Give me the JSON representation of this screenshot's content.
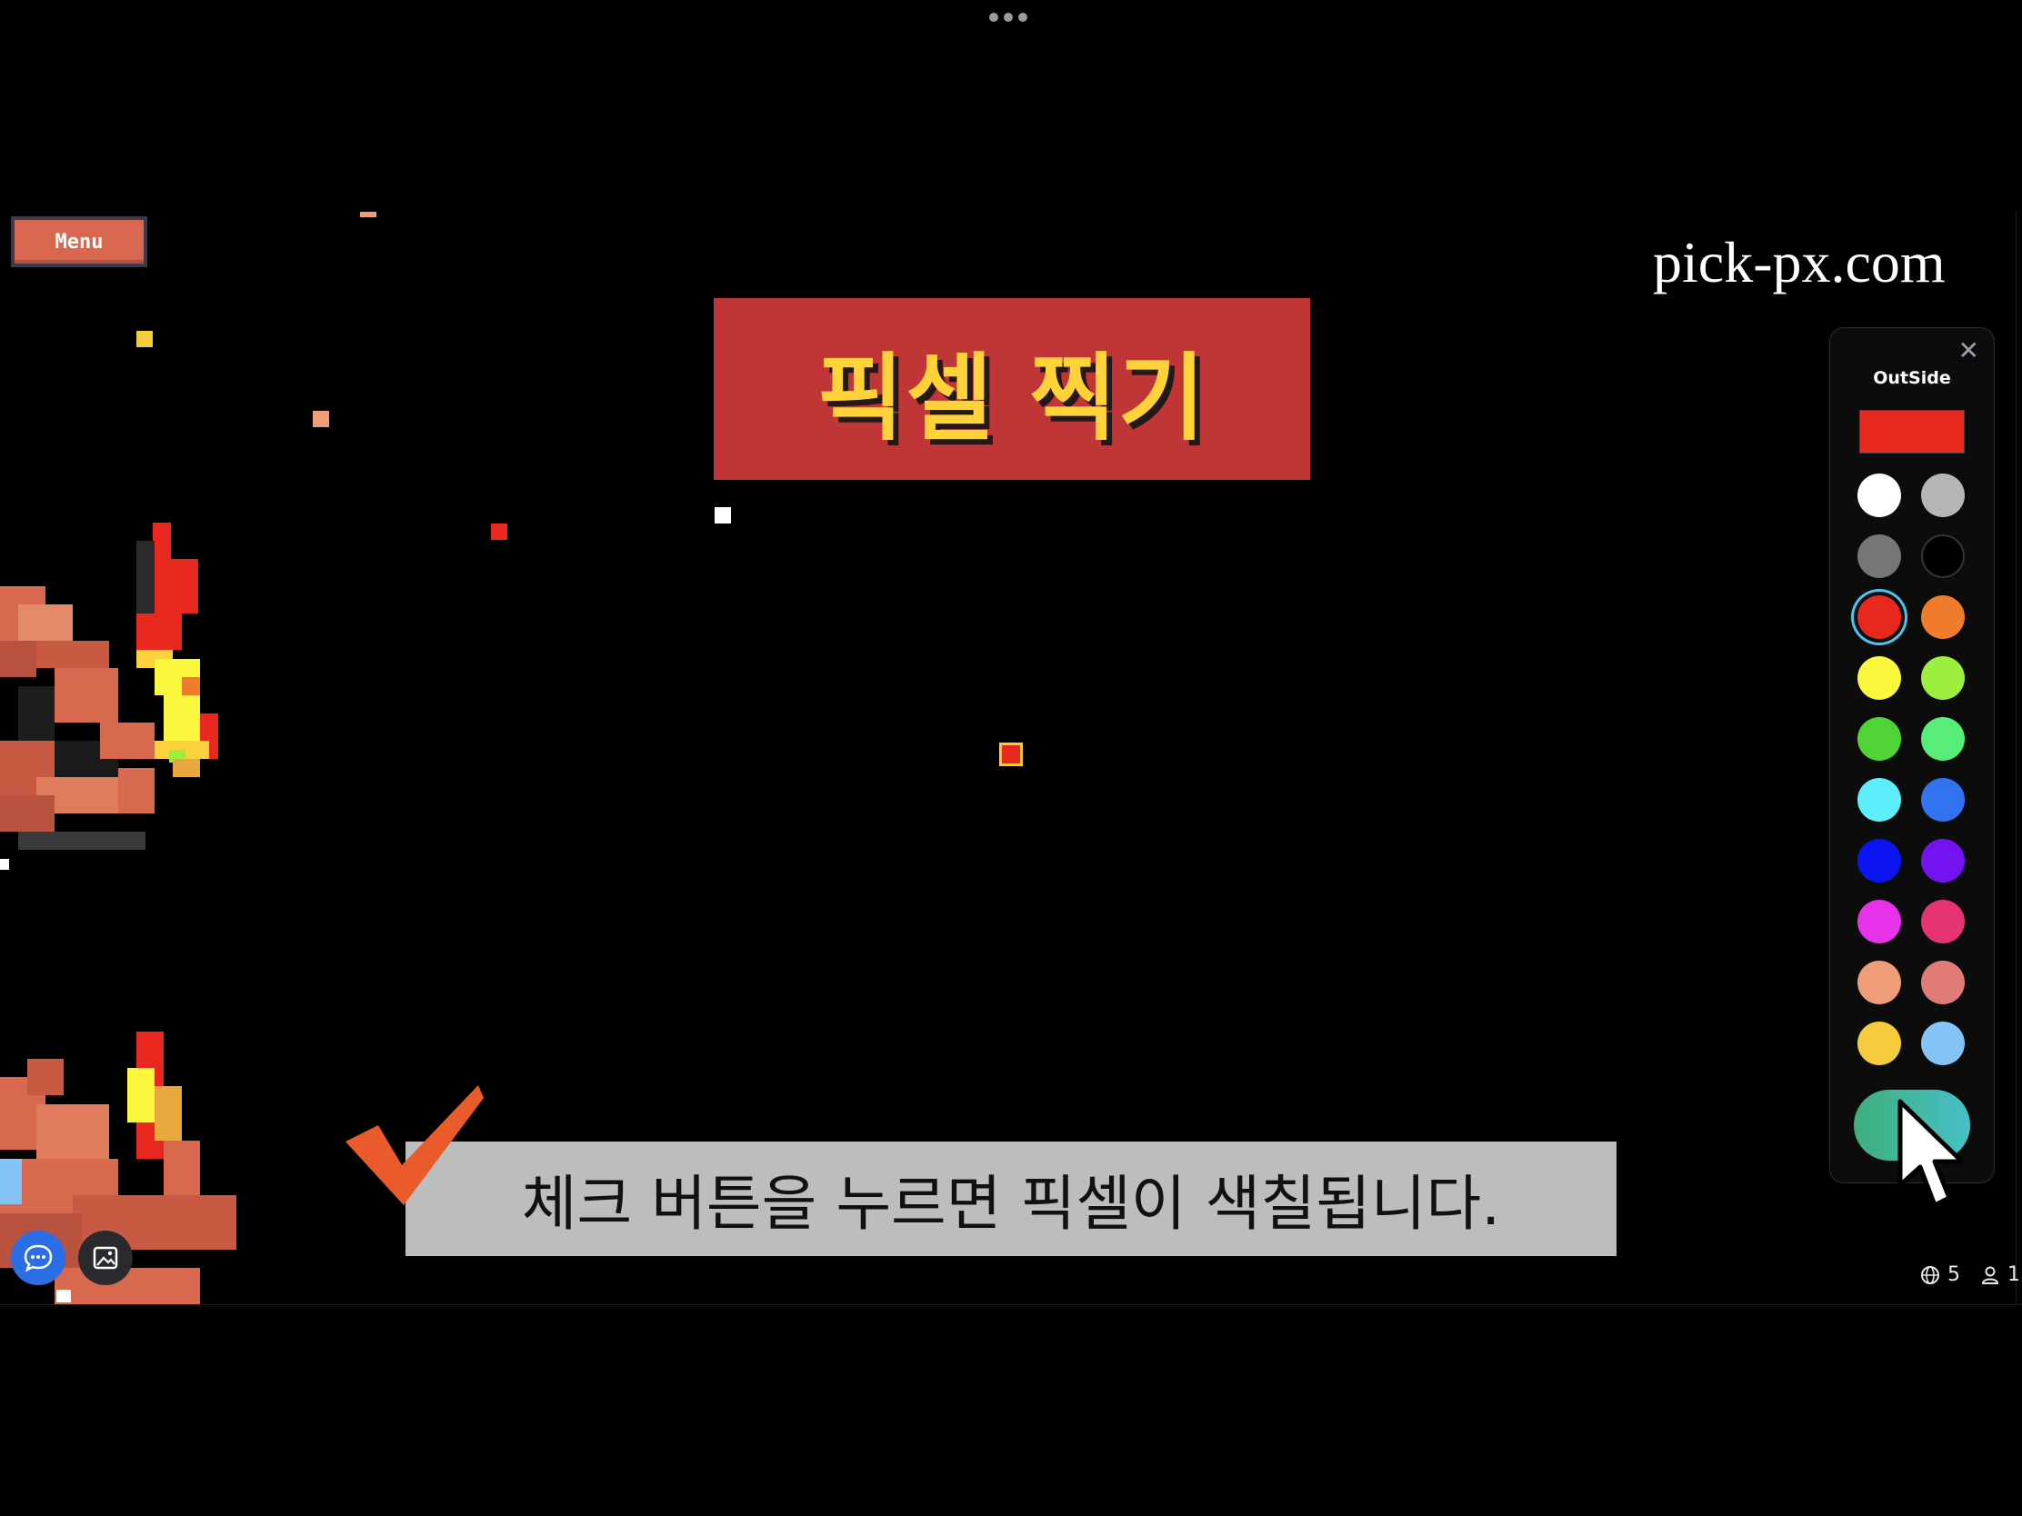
{
  "toolbar": {
    "menu_label": "Menu"
  },
  "site_label": "pick-px.com",
  "title_banner": "픽셀 찍기",
  "subtitle": "체크 버튼을 누르면 픽셀이 색칠됩니다.",
  "palette": {
    "title": "OutSide",
    "selected_color": "#e8281e",
    "swatches": [
      "#ffffff",
      "#b5b5b5",
      "#767676",
      "#000000",
      "#e8281e",
      "#ef7b2c",
      "#fbf63e",
      "#9cef3e",
      "#4fd336",
      "#58ec79",
      "#5eeefb",
      "#3272ef",
      "#0b14f1",
      "#7314f0",
      "#e832ea",
      "#e53375",
      "#ef9c79",
      "#e07b76",
      "#f7cc3c",
      "#86c3f7"
    ],
    "selected_index": 4,
    "confirm_colors": [
      "#3eaf7b",
      "#47c0c8"
    ]
  },
  "status": {
    "online": "5",
    "users": "1"
  },
  "icons": {
    "close": "close-icon",
    "chat": "chat-bubble-icon",
    "image": "image-icon",
    "globe": "globe-icon",
    "user": "user-icon",
    "check": "check-mark-icon",
    "cursor": "mouse-cursor-icon"
  }
}
